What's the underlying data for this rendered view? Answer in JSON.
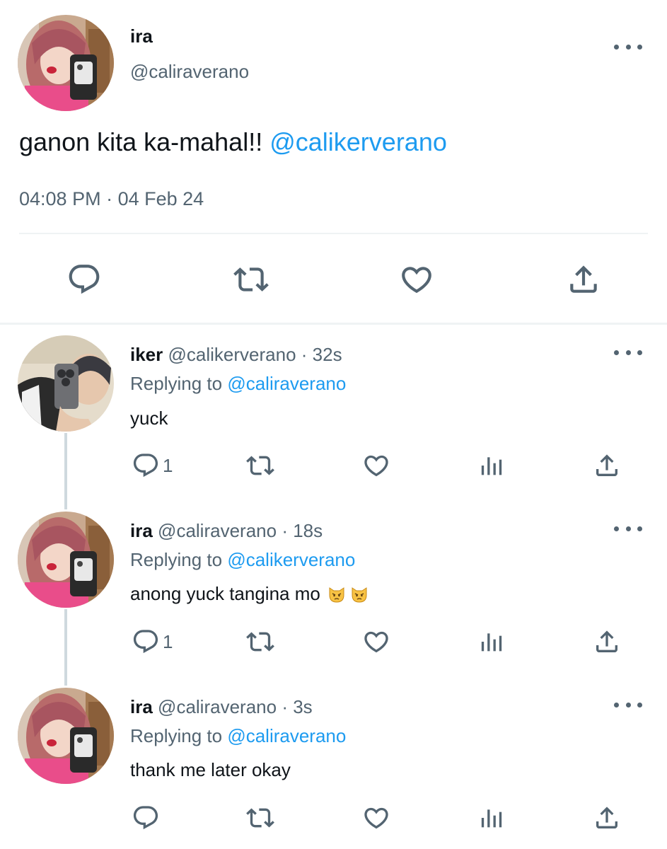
{
  "main_tweet": {
    "display_name": "ira",
    "handle": "@caliraverano",
    "text": "ganon kita ka-mahal!!",
    "mention": "@calikerverano",
    "time": "04:08 PM",
    "separator": "·",
    "date": "04 Feb 24",
    "actions": [
      "reply",
      "retweet",
      "like",
      "share"
    ]
  },
  "replies": [
    {
      "display_name": "iker",
      "handle": "@calikerverano",
      "separator": "·",
      "time": "32s",
      "replying_prefix": "Replying to",
      "replying_to": "@caliraverano",
      "text": "yuck",
      "reply_count": "1",
      "emoji": []
    },
    {
      "display_name": "ira",
      "handle": "@caliraverano",
      "separator": "·",
      "time": "18s",
      "replying_prefix": "Replying to",
      "replying_to": "@calikerverano",
      "text": "anong yuck tangina mo",
      "reply_count": "1",
      "emoji": [
        "pouting-cat",
        "pouting-cat"
      ]
    },
    {
      "display_name": "ira",
      "handle": "@caliraverano",
      "separator": "·",
      "time": "3s",
      "replying_prefix": "Replying to",
      "replying_to": "@caliraverano",
      "text": "thank me later okay",
      "reply_count": "",
      "emoji": []
    }
  ],
  "icons": {
    "reply": "speech-bubble-icon",
    "retweet": "retweet-icon",
    "like": "heart-icon",
    "views": "bar-chart-icon",
    "share": "share-icon",
    "more": "more-dots-icon"
  },
  "colors": {
    "text": "#0f1419",
    "secondary": "#536471",
    "link": "#1d9bf0",
    "divider": "#eff3f4",
    "thread_line": "#cfd9de"
  }
}
